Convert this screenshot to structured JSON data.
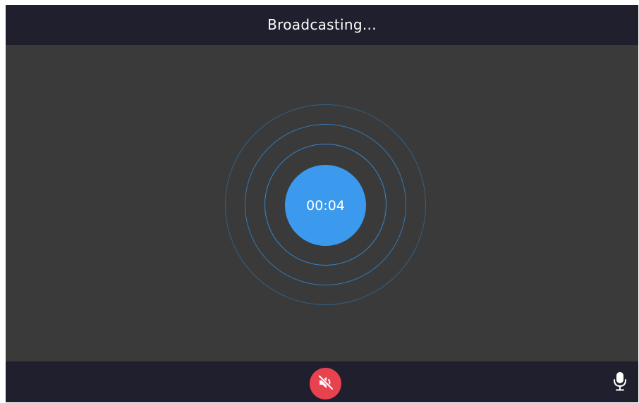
{
  "header": {
    "title": "Broadcasting..."
  },
  "broadcast": {
    "elapsed_time": "00:04"
  },
  "controls": {
    "speaker_button_icon": "speaker-muted-icon",
    "mic_button_icon": "microphone-icon"
  },
  "colors": {
    "bar_background": "#1f1f2e",
    "stage_background": "#3a3a3a",
    "timer_disc": "#3c9aee",
    "ring_stroke": "#348cd6",
    "mute_button": "#e8424f"
  }
}
